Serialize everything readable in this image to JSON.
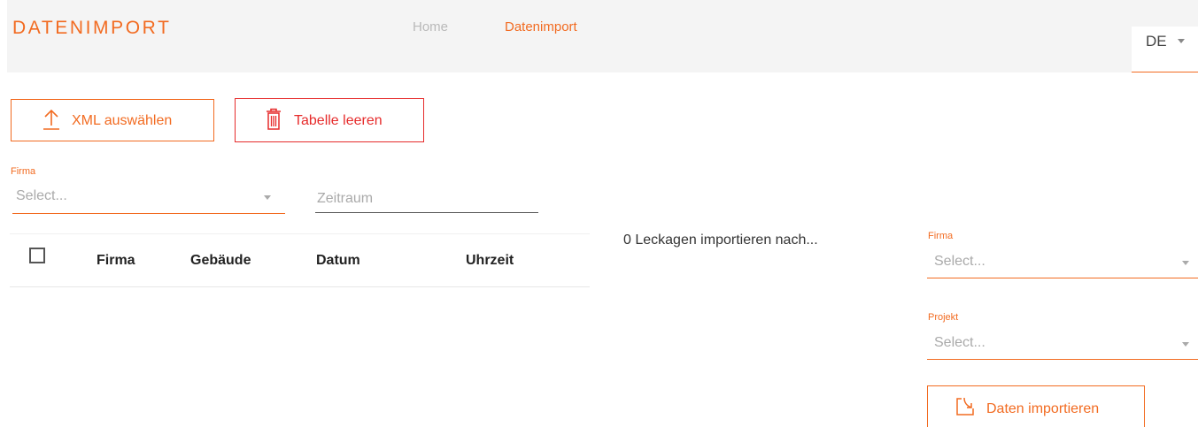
{
  "header": {
    "brand": "DATENIMPORT",
    "nav": {
      "home": "Home",
      "import": "Datenimport"
    },
    "language": "DE"
  },
  "toolbar": {
    "xml_button": "XML auswählen",
    "clear_button": "Tabelle leeren"
  },
  "filters": {
    "firma_label": "Firma",
    "firma_placeholder": "Select...",
    "zeitraum_placeholder": "Zeitraum"
  },
  "table": {
    "columns": [
      "Firma",
      "Gebäude",
      "Datum",
      "Uhrzeit"
    ]
  },
  "import_panel": {
    "info_text": "0 Leckagen importieren nach...",
    "firma_label": "Firma",
    "firma_placeholder": "Select...",
    "projekt_label": "Projekt",
    "projekt_placeholder": "Select...",
    "import_button": "Daten importieren"
  },
  "colors": {
    "accent": "#f26b21",
    "danger": "#e62b2b",
    "header_bg": "#f4f4f4"
  },
  "icons": {
    "xml_button": "upload-icon",
    "clear_button": "trash-icon",
    "import_button": "download-tray-icon"
  }
}
